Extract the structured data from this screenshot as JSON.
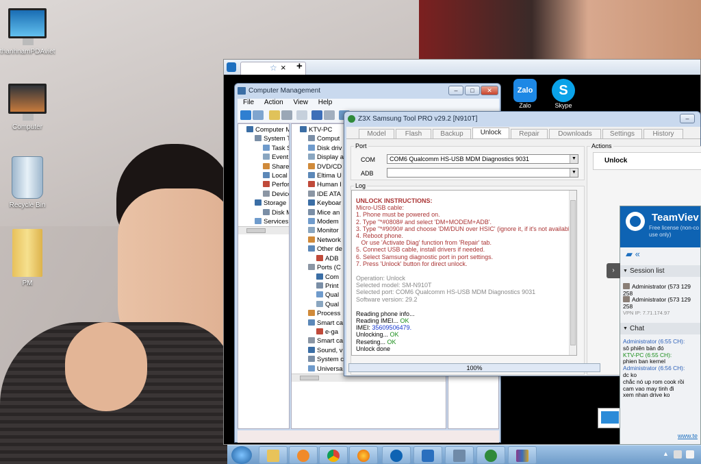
{
  "desktop": {
    "icons": [
      {
        "label": "thanhnamPDAviet",
        "icon": "monitor-icon"
      },
      {
        "label": "Computer",
        "icon": "monitor-icon"
      },
      {
        "label": "Recycle Bin",
        "icon": "recycle-bin-icon"
      },
      {
        "label": "PM",
        "icon": "folder-icon"
      }
    ],
    "shortcuts": [
      {
        "label": "Zalo",
        "icon_text": "Zalo"
      },
      {
        "label": "Skype",
        "icon_text": "S"
      }
    ]
  },
  "browser": {
    "tab_close": "×",
    "new_tab": "+",
    "star": "☆"
  },
  "computer_management": {
    "title": "Computer Management",
    "menu": [
      "File",
      "Action",
      "View",
      "Help"
    ],
    "left_tree": [
      {
        "label": "Computer Ma",
        "indent": 0,
        "icon": "computer-icon"
      },
      {
        "label": "System To",
        "indent": 1,
        "icon": "tools-icon"
      },
      {
        "label": "Task S",
        "indent": 2,
        "icon": "task-icon"
      },
      {
        "label": "Event V",
        "indent": 2,
        "icon": "event-icon"
      },
      {
        "label": "Sharec",
        "indent": 2,
        "icon": "share-icon"
      },
      {
        "label": "Local U",
        "indent": 2,
        "icon": "users-icon"
      },
      {
        "label": "Perforn",
        "indent": 2,
        "icon": "perf-icon"
      },
      {
        "label": "Device",
        "indent": 2,
        "icon": "device-icon"
      },
      {
        "label": "Storage",
        "indent": 1,
        "icon": "storage-icon"
      },
      {
        "label": "Disk M",
        "indent": 2,
        "icon": "disk-icon"
      },
      {
        "label": "Services ar",
        "indent": 1,
        "icon": "services-icon"
      }
    ],
    "right_tree": [
      {
        "label": "KTV-PC",
        "indent": 0
      },
      {
        "label": "Comput",
        "indent": 1
      },
      {
        "label": "Disk driv",
        "indent": 1
      },
      {
        "label": "Display a",
        "indent": 1
      },
      {
        "label": "DVD/CD",
        "indent": 1
      },
      {
        "label": "Eltima U",
        "indent": 1
      },
      {
        "label": "Human I",
        "indent": 1
      },
      {
        "label": "IDE ATA",
        "indent": 1
      },
      {
        "label": "Keyboar",
        "indent": 1
      },
      {
        "label": "Mice an",
        "indent": 1
      },
      {
        "label": "Modem",
        "indent": 1
      },
      {
        "label": "Monitor",
        "indent": 1
      },
      {
        "label": "Network",
        "indent": 1
      },
      {
        "label": "Other de",
        "indent": 1
      },
      {
        "label": "ADB",
        "indent": 2
      },
      {
        "label": "Ports (C",
        "indent": 1
      },
      {
        "label": "Com",
        "indent": 2
      },
      {
        "label": "Print",
        "indent": 2
      },
      {
        "label": "Qual",
        "indent": 2
      },
      {
        "label": "Qual",
        "indent": 2
      },
      {
        "label": "Process",
        "indent": 1
      },
      {
        "label": "Smart ca",
        "indent": 1
      },
      {
        "label": "e-ga",
        "indent": 2
      },
      {
        "label": "Smart ca",
        "indent": 1
      },
      {
        "label": "Sound, v",
        "indent": 1
      },
      {
        "label": "System c",
        "indent": 1
      },
      {
        "label": "Universa",
        "indent": 1
      }
    ]
  },
  "z3x": {
    "title": "Z3X Samsung Tool PRO v29.2 [N910T]",
    "tabs": [
      "Model",
      "Flash",
      "Backup",
      "Unlock",
      "Repair",
      "Downloads",
      "Settings",
      "History"
    ],
    "active_tab": "Unlock",
    "port_label": "Port",
    "com_label": "COM",
    "com_value": "COM6 Qualcomm HS-USB MDM Diagnostics 9031",
    "adb_label": "ADB",
    "adb_value": "",
    "actions_label": "Actions",
    "unlock_button": "Unlock",
    "log_label": "Log",
    "progress": "100%",
    "log": {
      "heading": "UNLOCK INSTRUCTIONS:",
      "instructions": [
        "Micro-USB cable:",
        "1. Phone must be powered on.",
        "2. Type \"*#0808# and select 'DM+MODEM+ADB'.",
        "3. Type \"*#9090# and choose 'DM/DUN over HSIC' (ignore it, if it's not available).",
        "4. Reboot phone.",
        "   Or use 'Activate Diag' function from 'Repair' tab.",
        "5. Connect USB cable, install drivers if needed.",
        "6. Select Samsung diagnostic port in port settings.",
        "7. Press 'Unlock' button for direct unlock."
      ],
      "info": [
        "Operation: Unlock",
        "Selected model: SM-N910T",
        "Selected port: COM6 Qualcomm HS-USB MDM Diagnostics 9031",
        "Software version: 29.2"
      ],
      "steps": {
        "reading_phone": "Reading phone info...",
        "reading_imei": "Reading IMEI...",
        "imei_ok": "OK",
        "imei_label": "IMEI:",
        "imei_value": "35609506479.",
        "unlocking": "Unlocking...",
        "unlocking_ok": "OK",
        "reseting": "Reseting...",
        "reseting_ok": "OK",
        "done": "Unlock done"
      }
    }
  },
  "teamviewer": {
    "title": "TeamViev",
    "subtitle1": "Free license (non-co",
    "subtitle2": "use only)",
    "session_list": "Session list",
    "sessions": [
      "Administrator (573 129 258",
      "Administrator (573 129 258"
    ],
    "vpn": "VPN IP: 7.71.174.97",
    "chat_label": "Chat",
    "chat": [
      {
        "text": "Administrator (6:55 CH):",
        "cls": "blue"
      },
      {
        "text": "sô phiên bản đó",
        "cls": ""
      },
      {
        "text": "KTV-PC (6:55 CH):",
        "cls": "green"
      },
      {
        "text": "phien ban kernel",
        "cls": ""
      },
      {
        "text": "Administrator (6:56 CH):",
        "cls": "blue"
      },
      {
        "text": "dc ko",
        "cls": ""
      },
      {
        "text": "chắc nó up rom cook rồi",
        "cls": ""
      },
      {
        "text": "cam vao may tinh đi",
        "cls": ""
      },
      {
        "text": "xem nhan drive ko",
        "cls": ""
      }
    ],
    "footer_link": "www.te"
  },
  "colors": {
    "accent": "#1d6fbf",
    "taskbar": "#8ab1d8",
    "ok": "#1a8d1a",
    "instruction": "#a33333"
  }
}
